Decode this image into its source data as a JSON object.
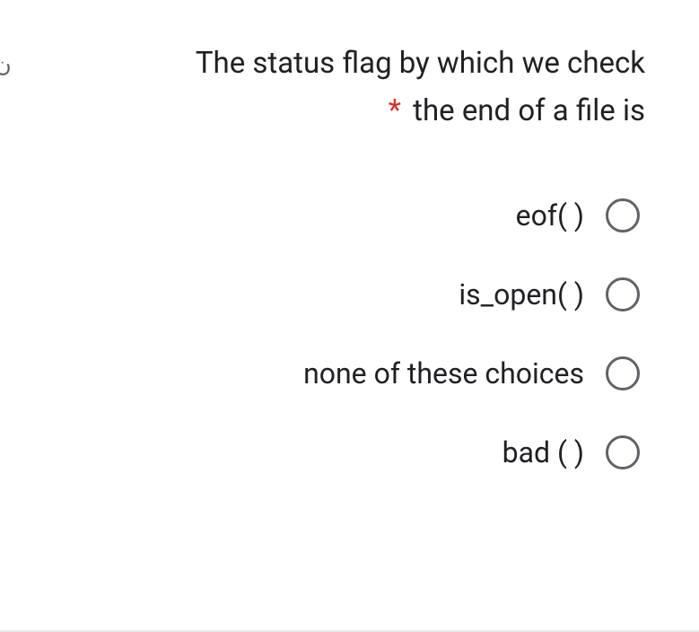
{
  "partial_left_text": "ن",
  "question": {
    "line1": "The status flag by which we check",
    "line2": "the end of a file is",
    "required_mark": "*"
  },
  "options": [
    {
      "label": "eof( )"
    },
    {
      "label": "is_open( )"
    },
    {
      "label": "none of these choices"
    },
    {
      "label": "bad ( )"
    }
  ]
}
